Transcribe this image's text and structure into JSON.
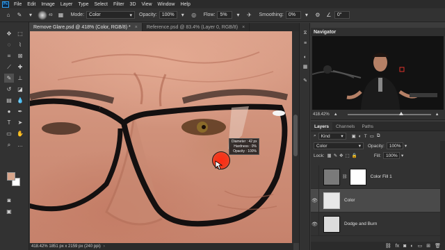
{
  "menubar": {
    "logo": "Ps",
    "items": [
      "File",
      "Edit",
      "Image",
      "Layer",
      "Type",
      "Select",
      "Filter",
      "3D",
      "View",
      "Window",
      "Help"
    ]
  },
  "options": {
    "brush_size": "49",
    "mode_label": "Mode:",
    "mode_value": "Color",
    "opacity_label": "Opacity:",
    "opacity_value": "100%",
    "flow_label": "Flow:",
    "flow_value": "5%",
    "smoothing_label": "Smoothing:",
    "smoothing_value": "0%",
    "angle_value": "0°"
  },
  "tabs": [
    {
      "label": "Remove Glare.psd @ 418% (Color, RGB/8) *"
    },
    {
      "label": "Reference.psd @ 83.4% (Layer 0, RGB/8)"
    }
  ],
  "brush_tooltip": {
    "diameter": "Diameter :  42 px",
    "hardness": "Hardness :     0%",
    "opacity": "Opacity :  100%"
  },
  "status": {
    "text": "418.42%   1851 px x 2159 px (240 ppi)"
  },
  "navigator": {
    "title": "Navigator",
    "zoom": "418.42%"
  },
  "layers_panel": {
    "tabs": [
      "Layers",
      "Channels",
      "Paths"
    ],
    "kind_value": "Kind",
    "blend_value": "Color",
    "opacity_label": "Opacity:",
    "opacity_value": "100%",
    "lock_label": "Lock:",
    "fill_label": "Fill:",
    "fill_value": "100%",
    "layers": [
      {
        "name": "Color Fill 1"
      },
      {
        "name": "Color"
      },
      {
        "name": "Dodge and Burn"
      }
    ]
  },
  "colors": {
    "foreground": "#d8a58b",
    "background": "#ffffff",
    "brush_cursor": "#f03a1e"
  }
}
